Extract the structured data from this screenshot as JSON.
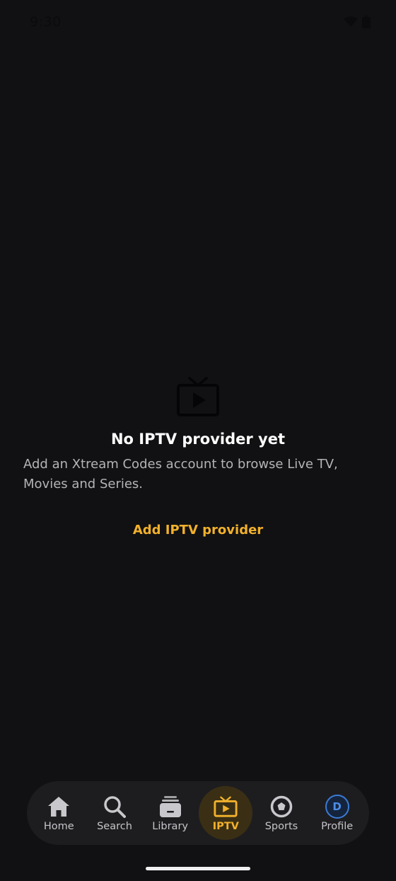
{
  "status_bar": {
    "time": "9:30"
  },
  "empty_state": {
    "icon": "live-tv-icon",
    "title": "No IPTV provider yet",
    "description": "Add an Xtream Codes account to browse Live TV, Movies and Series.",
    "action_label": "Add IPTV provider"
  },
  "nav": {
    "items": [
      {
        "label": "Home",
        "icon": "home-icon"
      },
      {
        "label": "Search",
        "icon": "search-icon"
      },
      {
        "label": "Library",
        "icon": "library-icon"
      },
      {
        "label": "IPTV",
        "icon": "tv-icon",
        "active": true
      },
      {
        "label": "Sports",
        "icon": "sports-icon"
      },
      {
        "label": "Profile",
        "icon": "avatar",
        "avatar_letter": "D"
      }
    ]
  },
  "colors": {
    "background": "#111113",
    "accent": "#f2b12c",
    "nav_background": "#1d1d20",
    "avatar_ring": "#3a7bd5"
  }
}
